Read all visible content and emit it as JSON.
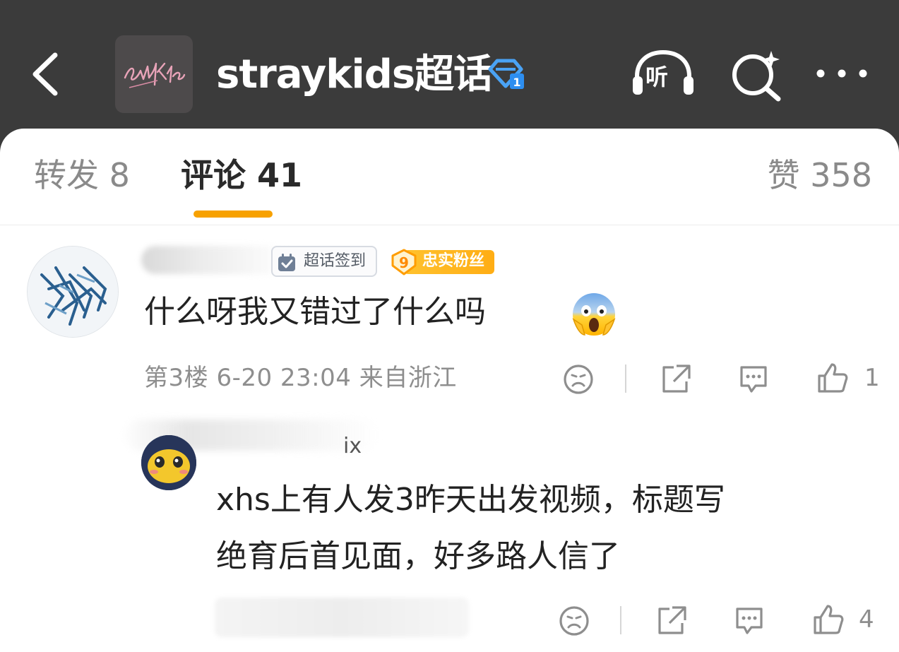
{
  "header": {
    "title": "straykids超话",
    "listen_label": "听",
    "icons": {
      "back": "back-arrow-icon",
      "logo": "straykids-logo",
      "badge": "verified-diamond-icon",
      "listen": "headphones-icon",
      "search": "ai-search-icon",
      "more": "more-dots-icon"
    }
  },
  "tabs": [
    {
      "label": "转发 8"
    },
    {
      "label": "评论 41",
      "active": true
    },
    {
      "label": "赞 358"
    }
  ],
  "comment": {
    "tag_checkin": "超话签到",
    "fan_level": "9",
    "tag_fan": "忠实粉丝",
    "text": "什么呀我又错过了什么吗",
    "emoji": "screaming-face-emoji",
    "meta": "第3楼 6-20 23:04 来自浙江",
    "like_count": "1"
  },
  "reply": {
    "name_suffix": "ix",
    "text_lines": [
      "xhs上有人发3昨天出发视频，标题写",
      "绝育后首见面，好多路人信了"
    ],
    "like_count": "4"
  },
  "colors": {
    "header_bg": "#3b3b3b",
    "tab_accent": "#f7a100",
    "fan_tag": "#ffb31e",
    "text": "#222222",
    "muted": "#8e8e8e"
  }
}
